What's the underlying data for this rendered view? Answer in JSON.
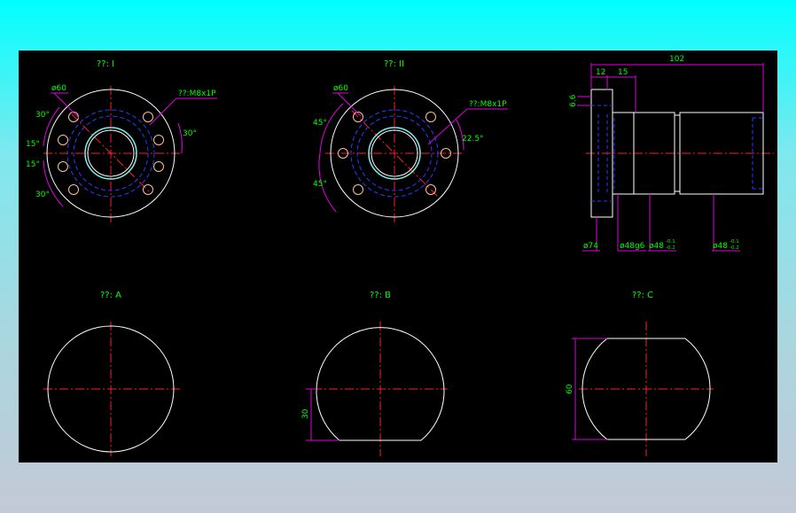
{
  "colors": {
    "background": "#000000",
    "outline": "#ffffff",
    "centerline": "#ff2020",
    "hidden": "#2a3cff",
    "dimension": "#e000e0",
    "text": "#00ff00",
    "bore": "#7ff0f0",
    "bolt_hole": "#ffc090"
  },
  "view1": {
    "title": "??: I",
    "dia_label": "ø60",
    "thread_label": "??:M8x1P",
    "angles": [
      "30°",
      "15°",
      "15°",
      "30°",
      "30°"
    ]
  },
  "view2": {
    "title": "??: II",
    "dia_label": "ø60",
    "thread_label": "??:M8x1P",
    "angles": [
      "45°",
      "45°",
      "22.5°"
    ]
  },
  "view3": {
    "dims_top": [
      "12",
      "15",
      "102"
    ],
    "dim_left": "6.6",
    "dims_bottom": {
      "d74": "ø74",
      "d48g6": "ø48g6",
      "d48a_base": "ø48",
      "d48a_upper": "-0.1",
      "d48a_lower": "-0.2",
      "d48b_base": "ø48",
      "d48b_upper": "-0.1",
      "d48b_lower": "-0.2"
    }
  },
  "viewA": {
    "title": "??: A"
  },
  "viewB": {
    "title": "??: B",
    "dim": "30"
  },
  "viewC": {
    "title": "??: C",
    "dim": "60"
  }
}
